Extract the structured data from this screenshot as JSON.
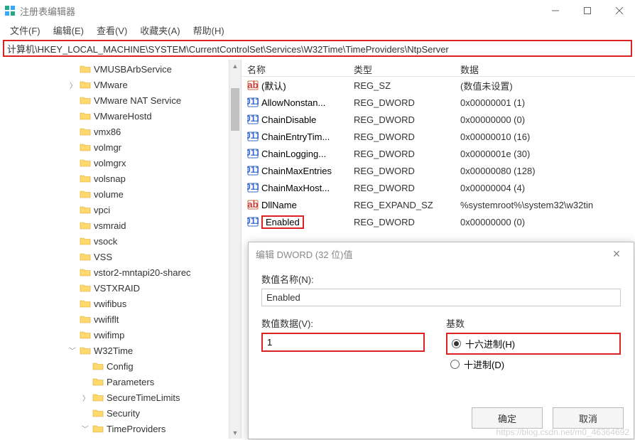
{
  "window": {
    "title": "注册表编辑器",
    "address": "计算机\\HKEY_LOCAL_MACHINE\\SYSTEM\\CurrentControlSet\\Services\\W32Time\\TimeProviders\\NtpServer"
  },
  "menu": {
    "file": "文件(F)",
    "edit": "编辑(E)",
    "view": "查看(V)",
    "favorites": "收藏夹(A)",
    "help": "帮助(H)"
  },
  "tree": [
    {
      "indent": 0,
      "expander": "",
      "label": "VMUSBArbService"
    },
    {
      "indent": 0,
      "expander": ">",
      "label": "VMware"
    },
    {
      "indent": 0,
      "expander": "",
      "label": "VMware NAT Service"
    },
    {
      "indent": 0,
      "expander": "",
      "label": "VMwareHostd"
    },
    {
      "indent": 0,
      "expander": "",
      "label": "vmx86"
    },
    {
      "indent": 0,
      "expander": "",
      "label": "volmgr"
    },
    {
      "indent": 0,
      "expander": "",
      "label": "volmgrx"
    },
    {
      "indent": 0,
      "expander": "",
      "label": "volsnap"
    },
    {
      "indent": 0,
      "expander": "",
      "label": "volume"
    },
    {
      "indent": 0,
      "expander": "",
      "label": "vpci"
    },
    {
      "indent": 0,
      "expander": "",
      "label": "vsmraid"
    },
    {
      "indent": 0,
      "expander": "",
      "label": "vsock"
    },
    {
      "indent": 0,
      "expander": "",
      "label": "VSS"
    },
    {
      "indent": 0,
      "expander": "",
      "label": "vstor2-mntapi20-sharec"
    },
    {
      "indent": 0,
      "expander": "",
      "label": "VSTXRAID"
    },
    {
      "indent": 0,
      "expander": "",
      "label": "vwifibus"
    },
    {
      "indent": 0,
      "expander": "",
      "label": "vwififlt"
    },
    {
      "indent": 0,
      "expander": "",
      "label": "vwifimp"
    },
    {
      "indent": 0,
      "expander": "v",
      "label": "W32Time"
    },
    {
      "indent": 1,
      "expander": "",
      "label": "Config"
    },
    {
      "indent": 1,
      "expander": "",
      "label": "Parameters"
    },
    {
      "indent": 1,
      "expander": ">",
      "label": "SecureTimeLimits"
    },
    {
      "indent": 1,
      "expander": "",
      "label": "Security"
    },
    {
      "indent": 1,
      "expander": "v",
      "label": "TimeProviders"
    }
  ],
  "list": {
    "headers": {
      "name": "名称",
      "type": "类型",
      "data": "数据"
    },
    "rows": [
      {
        "icon": "str",
        "name": "(默认)",
        "type": "REG_SZ",
        "data": "(数值未设置)"
      },
      {
        "icon": "bin",
        "name": "AllowNonstan...",
        "type": "REG_DWORD",
        "data": "0x00000001 (1)"
      },
      {
        "icon": "bin",
        "name": "ChainDisable",
        "type": "REG_DWORD",
        "data": "0x00000000 (0)"
      },
      {
        "icon": "bin",
        "name": "ChainEntryTim...",
        "type": "REG_DWORD",
        "data": "0x00000010 (16)"
      },
      {
        "icon": "bin",
        "name": "ChainLogging...",
        "type": "REG_DWORD",
        "data": "0x0000001e (30)"
      },
      {
        "icon": "bin",
        "name": "ChainMaxEntries",
        "type": "REG_DWORD",
        "data": "0x00000080 (128)"
      },
      {
        "icon": "bin",
        "name": "ChainMaxHost...",
        "type": "REG_DWORD",
        "data": "0x00000004 (4)"
      },
      {
        "icon": "str",
        "name": "DllName",
        "type": "REG_EXPAND_SZ",
        "data": "%systemroot%\\system32\\w32tin"
      },
      {
        "icon": "bin",
        "name": "Enabled",
        "type": "REG_DWORD",
        "data": "0x00000000 (0)",
        "highlighted": true
      }
    ]
  },
  "dialog": {
    "title": "编辑 DWORD (32 位)值",
    "name_label": "数值名称(N):",
    "name_value": "Enabled",
    "data_label": "数值数据(V):",
    "data_value": "1",
    "base_label": "基数",
    "radio_hex": "十六进制(H)",
    "radio_dec": "十进制(D)",
    "ok": "确定",
    "cancel": "取消"
  },
  "watermark": "https://blog.csdn.net/m0_46364692"
}
